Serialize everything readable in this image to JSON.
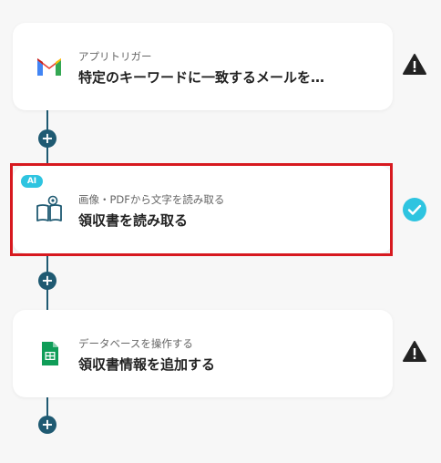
{
  "steps": [
    {
      "subtitle": "アプリトリガー",
      "title": "特定のキーワードに一致するメールを…",
      "icon": "gmail-icon",
      "status": "warning"
    },
    {
      "badge": "AI",
      "subtitle": "画像・PDFから文字を読み取る",
      "title": "領収書を読み取る",
      "icon": "book-reader-icon",
      "status": "success"
    },
    {
      "subtitle": "データベースを操作する",
      "title": "領収書情報を追加する",
      "icon": "google-sheets-icon",
      "status": "warning"
    }
  ],
  "add_label": "+",
  "colors": {
    "accent": "#1f5a72",
    "success": "#2ec4e0",
    "warning": "#222222",
    "selection": "#d7191f"
  }
}
